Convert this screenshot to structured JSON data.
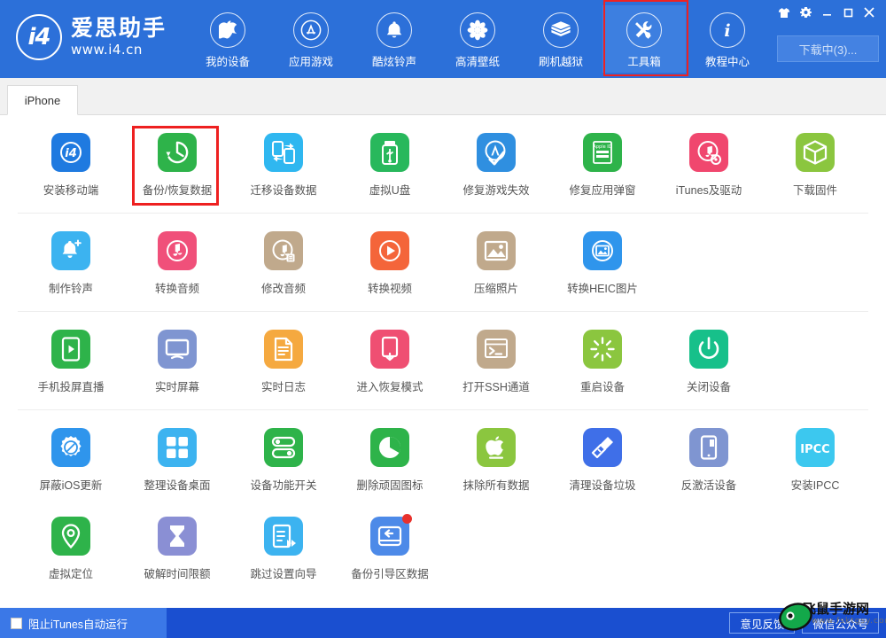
{
  "brand": {
    "logo_text": "i4",
    "name": "爱思助手",
    "url": "www.i4.cn"
  },
  "nav": {
    "items": [
      {
        "label": "我的设备",
        "icon": "apple-icon",
        "active": false,
        "boxed": false
      },
      {
        "label": "应用游戏",
        "icon": "appstore-icon",
        "active": false,
        "boxed": false
      },
      {
        "label": "酷炫铃声",
        "icon": "bell-icon",
        "active": false,
        "boxed": false
      },
      {
        "label": "高清壁纸",
        "icon": "flower-icon",
        "active": false,
        "boxed": false
      },
      {
        "label": "刷机越狱",
        "icon": "flash-box-icon",
        "active": false,
        "boxed": false
      },
      {
        "label": "工具箱",
        "icon": "tools-icon",
        "active": true,
        "boxed": true
      },
      {
        "label": "教程中心",
        "icon": "info-icon",
        "active": false,
        "boxed": false
      }
    ]
  },
  "window_controls": [
    {
      "name": "skin-icon",
      "glyph": "skin"
    },
    {
      "name": "settings-gear-icon",
      "glyph": "gear"
    },
    {
      "name": "minimize-icon",
      "glyph": "minimize"
    },
    {
      "name": "maximize-icon",
      "glyph": "maximize"
    },
    {
      "name": "close-icon",
      "glyph": "close"
    }
  ],
  "download_button": {
    "label": "下载中(3)..."
  },
  "tabs": [
    {
      "label": "iPhone",
      "active": true
    }
  ],
  "tool_groups": [
    {
      "group": "data",
      "tools": [
        {
          "label": "安装移动端",
          "icon": "i4-app-icon",
          "color": "#1f7ae0",
          "boxed": false,
          "badge": false
        },
        {
          "label": "备份/恢复数据",
          "icon": "backup-restore-icon",
          "color": "#2eb34a",
          "boxed": true,
          "badge": false
        },
        {
          "label": "迁移设备数据",
          "icon": "migrate-data-icon",
          "color": "#2fb7f0",
          "boxed": false,
          "badge": false
        },
        {
          "label": "虚拟U盘",
          "icon": "usb-drive-icon",
          "color": "#28b85c",
          "boxed": false,
          "badge": false
        },
        {
          "label": "修复游戏失效",
          "icon": "fix-game-icon",
          "color": "#2f8fe0",
          "boxed": false,
          "badge": false
        },
        {
          "label": "修复应用弹窗",
          "icon": "apple-id-icon",
          "color": "#2eb34a",
          "boxed": false,
          "badge": false
        },
        {
          "label": "iTunes及驱动",
          "icon": "itunes-driver-icon",
          "color": "#f0476e",
          "boxed": false,
          "badge": false
        },
        {
          "label": "下载固件",
          "icon": "firmware-box-icon",
          "color": "#8bc63f",
          "boxed": false,
          "badge": false
        }
      ]
    },
    {
      "group": "media",
      "tools": [
        {
          "label": "制作铃声",
          "icon": "make-ringtone-icon",
          "color": "#3cb3f0",
          "boxed": false,
          "badge": false
        },
        {
          "label": "转换音频",
          "icon": "convert-audio-icon",
          "color": "#f0507a",
          "boxed": false,
          "badge": false
        },
        {
          "label": "修改音频",
          "icon": "edit-audio-icon",
          "color": "#c0a98c",
          "boxed": false,
          "badge": false
        },
        {
          "label": "转换视频",
          "icon": "convert-video-icon",
          "color": "#f4653a",
          "boxed": false,
          "badge": false
        },
        {
          "label": "压缩照片",
          "icon": "compress-photo-icon",
          "color": "#c0a98c",
          "boxed": false,
          "badge": false
        },
        {
          "label": "转换HEIC图片",
          "icon": "convert-heic-icon",
          "color": "#2f95ec",
          "boxed": false,
          "badge": false
        }
      ]
    },
    {
      "group": "device",
      "tools": [
        {
          "label": "手机投屏直播",
          "icon": "screen-cast-icon",
          "color": "#2eb34a",
          "boxed": false,
          "badge": false
        },
        {
          "label": "实时屏幕",
          "icon": "live-screen-icon",
          "color": "#7f95d1",
          "boxed": false,
          "badge": false
        },
        {
          "label": "实时日志",
          "icon": "live-log-icon",
          "color": "#f5a940",
          "boxed": false,
          "badge": false
        },
        {
          "label": "进入恢复模式",
          "icon": "recovery-mode-icon",
          "color": "#ef4f72",
          "boxed": false,
          "badge": false
        },
        {
          "label": "打开SSH通道",
          "icon": "ssh-terminal-icon",
          "color": "#c0a98c",
          "boxed": false,
          "badge": false
        },
        {
          "label": "重启设备",
          "icon": "restart-device-icon",
          "color": "#8bc63f",
          "boxed": false,
          "badge": false
        },
        {
          "label": "关闭设备",
          "icon": "power-off-icon",
          "color": "#17c08a",
          "boxed": false,
          "badge": false
        }
      ]
    },
    {
      "group": "system",
      "tools": [
        {
          "label": "屏蔽iOS更新",
          "icon": "block-update-icon",
          "color": "#2f95ec",
          "boxed": false,
          "badge": false
        },
        {
          "label": "整理设备桌面",
          "icon": "organize-home-icon",
          "color": "#3cb3f0",
          "boxed": false,
          "badge": false
        },
        {
          "label": "设备功能开关",
          "icon": "toggle-switch-icon",
          "color": "#2eb34a",
          "boxed": false,
          "badge": false
        },
        {
          "label": "删除顽固图标",
          "icon": "remove-icon-icon",
          "color": "#2eb34a",
          "boxed": false,
          "badge": false
        },
        {
          "label": "抹除所有数据",
          "icon": "erase-all-icon",
          "color": "#8bc63f",
          "boxed": false,
          "badge": false
        },
        {
          "label": "清理设备垃圾",
          "icon": "clean-junk-icon",
          "color": "#3f6fe8",
          "boxed": false,
          "badge": false
        },
        {
          "label": "反激活设备",
          "icon": "deactivate-icon",
          "color": "#7f95d1",
          "boxed": false,
          "badge": false
        },
        {
          "label": "安装IPCC",
          "icon": "ipcc-icon",
          "color": "#3cc8ef",
          "boxed": false,
          "badge": false
        },
        {
          "label": "虚拟定位",
          "icon": "virtual-location-icon",
          "color": "#2eb34a",
          "boxed": false,
          "badge": false
        },
        {
          "label": "破解时间限额",
          "icon": "hourglass-icon",
          "color": "#8a8fd4",
          "boxed": false,
          "badge": false
        },
        {
          "label": "跳过设置向导",
          "icon": "skip-setup-icon",
          "color": "#3cb3f0",
          "boxed": false,
          "badge": false
        },
        {
          "label": "备份引导区数据",
          "icon": "backup-boot-icon",
          "color": "#4d8ae8",
          "boxed": false,
          "badge": true
        }
      ]
    }
  ],
  "statusbar": {
    "checkbox_label": "阻止iTunes自动运行",
    "checkbox_checked": false,
    "buttons": [
      {
        "label": "意见反馈"
      },
      {
        "label": "微信公众号"
      }
    ]
  },
  "watermark": {
    "text": "飞鼠手游网",
    "url": "www.fsktgsy.com"
  },
  "colors": {
    "header_blue": "#2c70d9",
    "header_active": "#3d7fe0",
    "status_blue": "#1a4fd0",
    "status_left_blue": "#3b78e7",
    "highlight_red": "#ee2020"
  }
}
